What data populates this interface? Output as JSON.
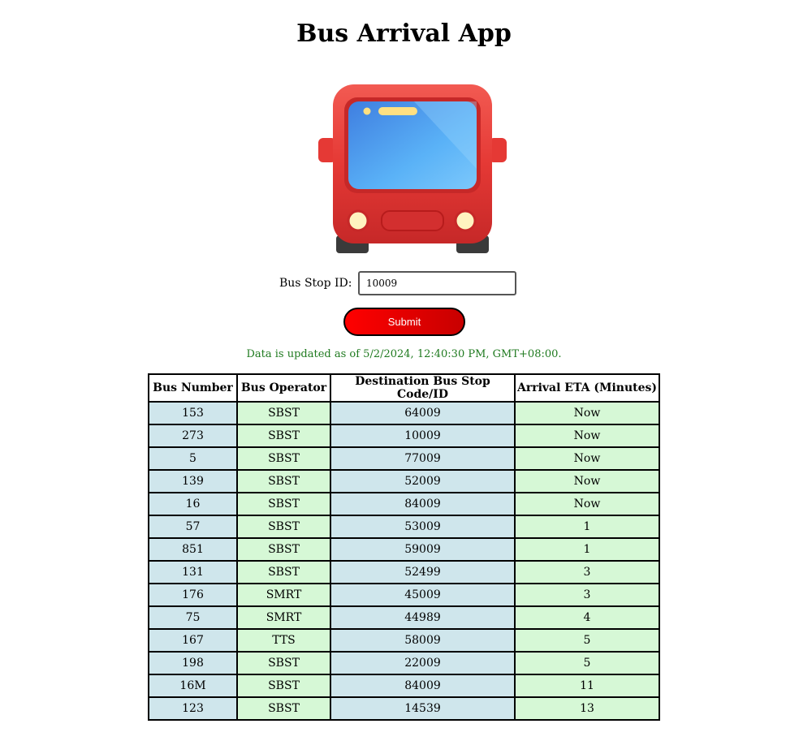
{
  "app": {
    "title": "Bus Arrival App"
  },
  "icon": {
    "name": "bus-icon",
    "body_color": "#e53935",
    "window_color": "#4fa3f7"
  },
  "form": {
    "label": "Bus Stop ID:",
    "input_value": "10009",
    "submit_label": "Submit"
  },
  "status": {
    "text": "Data is updated as of 5/2/2024, 12:40:30 PM, GMT+08:00."
  },
  "colors": {
    "status_text": "#1f7a1f",
    "button": "#e00000",
    "cell_blue": "#cfe6ec",
    "cell_green": "#d6f8d6"
  },
  "table": {
    "headers": [
      "Bus Number",
      "Bus Operator",
      "Destination Bus Stop Code/ID",
      "Arrival ETA (Minutes)"
    ],
    "rows": [
      [
        "153",
        "SBST",
        "64009",
        "Now"
      ],
      [
        "273",
        "SBST",
        "10009",
        "Now"
      ],
      [
        "5",
        "SBST",
        "77009",
        "Now"
      ],
      [
        "139",
        "SBST",
        "52009",
        "Now"
      ],
      [
        "16",
        "SBST",
        "84009",
        "Now"
      ],
      [
        "57",
        "SBST",
        "53009",
        "1"
      ],
      [
        "851",
        "SBST",
        "59009",
        "1"
      ],
      [
        "131",
        "SBST",
        "52499",
        "3"
      ],
      [
        "176",
        "SMRT",
        "45009",
        "3"
      ],
      [
        "75",
        "SMRT",
        "44989",
        "4"
      ],
      [
        "167",
        "TTS",
        "58009",
        "5"
      ],
      [
        "198",
        "SBST",
        "22009",
        "5"
      ],
      [
        "16M",
        "SBST",
        "84009",
        "11"
      ],
      [
        "123",
        "SBST",
        "14539",
        "13"
      ]
    ]
  }
}
